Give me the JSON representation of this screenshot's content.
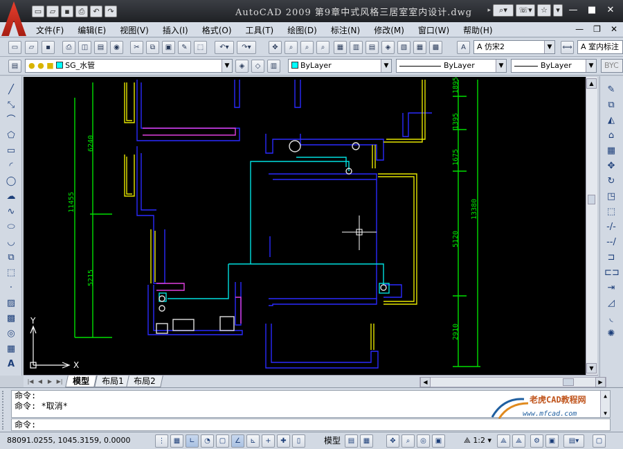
{
  "window": {
    "title": "AutoCAD 2009  第9章中式风格三居室室内设计.dwg",
    "app_logo": "autocad-logo"
  },
  "quick_access": [
    "new",
    "open",
    "save",
    "print",
    "undo",
    "redo"
  ],
  "menu": {
    "items": [
      "文件(F)",
      "编辑(E)",
      "视图(V)",
      "插入(I)",
      "格式(O)",
      "工具(T)",
      "绘图(D)",
      "标注(N)",
      "修改(M)",
      "窗口(W)",
      "帮助(H)"
    ]
  },
  "style_toolbar": {
    "text_style": "仿宋2",
    "dim_style": "室内标注"
  },
  "layers_toolbar": {
    "current_layer": "SG_水管",
    "layer_color": "#00ffff",
    "color_value": "ByLayer",
    "linetype_value": "ByLayer",
    "lineweight_value": "ByLayer",
    "plotstyle_value": "BYC"
  },
  "drawing": {
    "dimensions_left": [
      "6240",
      "11455",
      "5215"
    ],
    "dimensions_right": [
      "1895",
      "1395",
      "1675",
      "5120",
      "13380",
      "2910"
    ],
    "ucs_x_label": "X",
    "ucs_y_label": "Y",
    "colors": {
      "wall": "#2a2aff",
      "window": "#e6e600",
      "dimension": "#00e000",
      "pipe": "#00e0e0",
      "magenta": "#e040e0",
      "white": "#e0e0e0"
    }
  },
  "layout_tabs": [
    "模型",
    "布局1",
    "布局2"
  ],
  "command": {
    "history": [
      "命令:",
      "命令: *取消*"
    ],
    "prompt": "命令:"
  },
  "watermark": {
    "title": "老虎CAD教程网",
    "url": "www.mfcad.com"
  },
  "status": {
    "coordinates": "88091.0255, 1045.3159, 0.0000",
    "model_label": "模型",
    "annotation_scale": "1:2"
  }
}
